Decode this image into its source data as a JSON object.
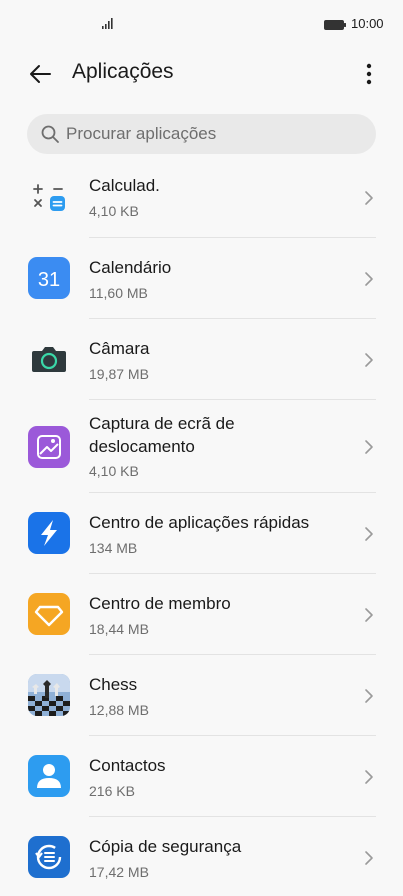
{
  "status_bar": {
    "time": "10:00"
  },
  "header": {
    "title": "Aplicações"
  },
  "search": {
    "placeholder": "Procurar aplicações"
  },
  "apps": [
    {
      "name": "Calculad.",
      "size": "4,10 KB",
      "icon": "calculator-icon"
    },
    {
      "name": "Calendário",
      "size": "11,60 MB",
      "icon": "calendar-icon",
      "icon_text": "31"
    },
    {
      "name": "Câmara",
      "size": "19,87 MB",
      "icon": "camera-icon"
    },
    {
      "name": "Captura de ecrã de deslocamento",
      "size": "4,10 KB",
      "icon": "scrolling-screenshot-icon"
    },
    {
      "name": "Centro de aplicações rápidas",
      "size": "134 MB",
      "icon": "quick-apps-icon"
    },
    {
      "name": "Centro de membro",
      "size": "18,44 MB",
      "icon": "member-center-icon"
    },
    {
      "name": "Chess",
      "size": "12,88 MB",
      "icon": "chess-icon"
    },
    {
      "name": "Contactos",
      "size": "216 KB",
      "icon": "contacts-icon"
    },
    {
      "name": "Cópia de segurança",
      "size": "17,42 MB",
      "icon": "backup-icon"
    }
  ],
  "colors": {
    "background": "#f8f8f8",
    "calendar": "#3b8cf2",
    "camera": "#2f3a3d",
    "screenshot": "#9b59d9",
    "quick_apps": "#1a73e8",
    "member": "#f5a623",
    "contacts": "#2d9cf0",
    "backup": "#1e6fcf"
  }
}
